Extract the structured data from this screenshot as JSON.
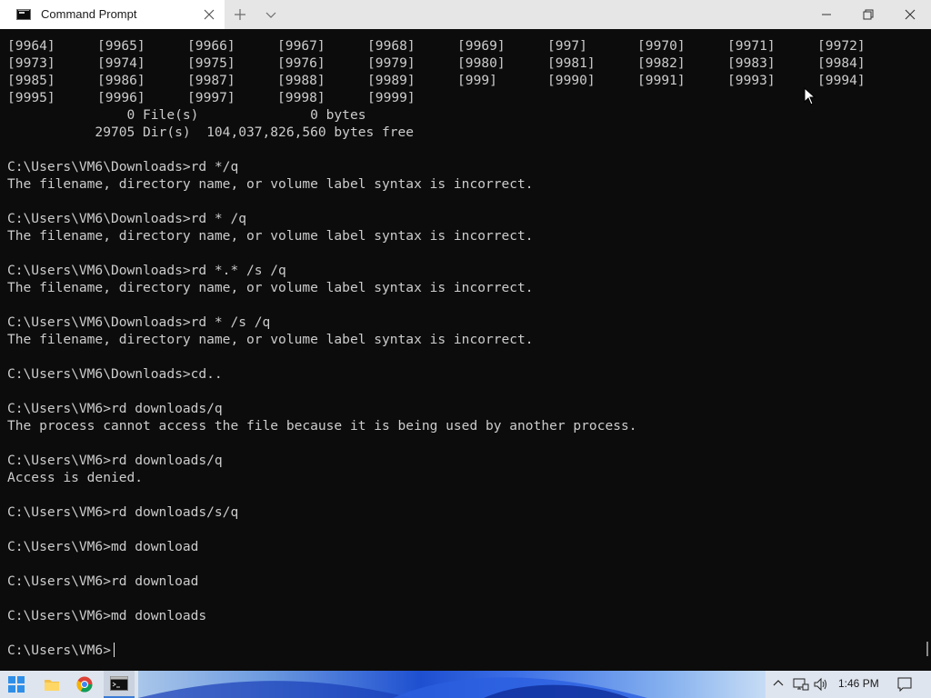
{
  "window": {
    "tab_title": "Command Prompt",
    "icons": {
      "tab": "command-prompt-icon",
      "close_tab": "close-icon",
      "new_tab": "plus-icon",
      "dropdown": "chevron-down-icon",
      "minimize": "minimize-icon",
      "maximize": "restore-icon",
      "close": "close-icon"
    }
  },
  "terminal": {
    "colors": {
      "background": "#0c0c0c",
      "text": "#cccccc"
    },
    "dir_rows": [
      [
        "[9964]",
        "[9965]",
        "[9966]",
        "[9967]",
        "[9968]",
        "[9969]",
        "[997]",
        "[9970]",
        "[9971]",
        "[9972]"
      ],
      [
        "[9973]",
        "[9974]",
        "[9975]",
        "[9976]",
        "[9979]",
        "[9980]",
        "[9981]",
        "[9982]",
        "[9983]",
        "[9984]"
      ],
      [
        "[9985]",
        "[9986]",
        "[9987]",
        "[9988]",
        "[9989]",
        "[999]",
        "[9990]",
        "[9991]",
        "[9993]",
        "[9994]"
      ],
      [
        "[9995]",
        "[9996]",
        "[9997]",
        "[9998]",
        "[9999]"
      ]
    ],
    "lines": [
      "               0 File(s)              0 bytes",
      "           29705 Dir(s)  104,037,826,560 bytes free",
      "",
      "C:\\Users\\VM6\\Downloads>rd */q",
      "The filename, directory name, or volume label syntax is incorrect.",
      "",
      "C:\\Users\\VM6\\Downloads>rd * /q",
      "The filename, directory name, or volume label syntax is incorrect.",
      "",
      "C:\\Users\\VM6\\Downloads>rd *.* /s /q",
      "The filename, directory name, or volume label syntax is incorrect.",
      "",
      "C:\\Users\\VM6\\Downloads>rd * /s /q",
      "The filename, directory name, or volume label syntax is incorrect.",
      "",
      "C:\\Users\\VM6\\Downloads>cd..",
      "",
      "C:\\Users\\VM6>rd downloads/q",
      "The process cannot access the file because it is being used by another process.",
      "",
      "C:\\Users\\VM6>rd downloads/q",
      "Access is denied.",
      "",
      "C:\\Users\\VM6>rd downloads/s/q",
      "",
      "C:\\Users\\VM6>md download",
      "",
      "C:\\Users\\VM6>rd download",
      "",
      "C:\\Users\\VM6>md downloads",
      "",
      "C:\\Users\\VM6>"
    ]
  },
  "taskbar": {
    "apps": [
      "windows-start-icon",
      "file-explorer-icon",
      "chrome-icon",
      "command-prompt-icon"
    ],
    "tray_icons": [
      "chevron-up-icon",
      "network-icon",
      "volume-icon"
    ],
    "clock": "1:46 PM",
    "notification_icon": "notification-icon"
  }
}
